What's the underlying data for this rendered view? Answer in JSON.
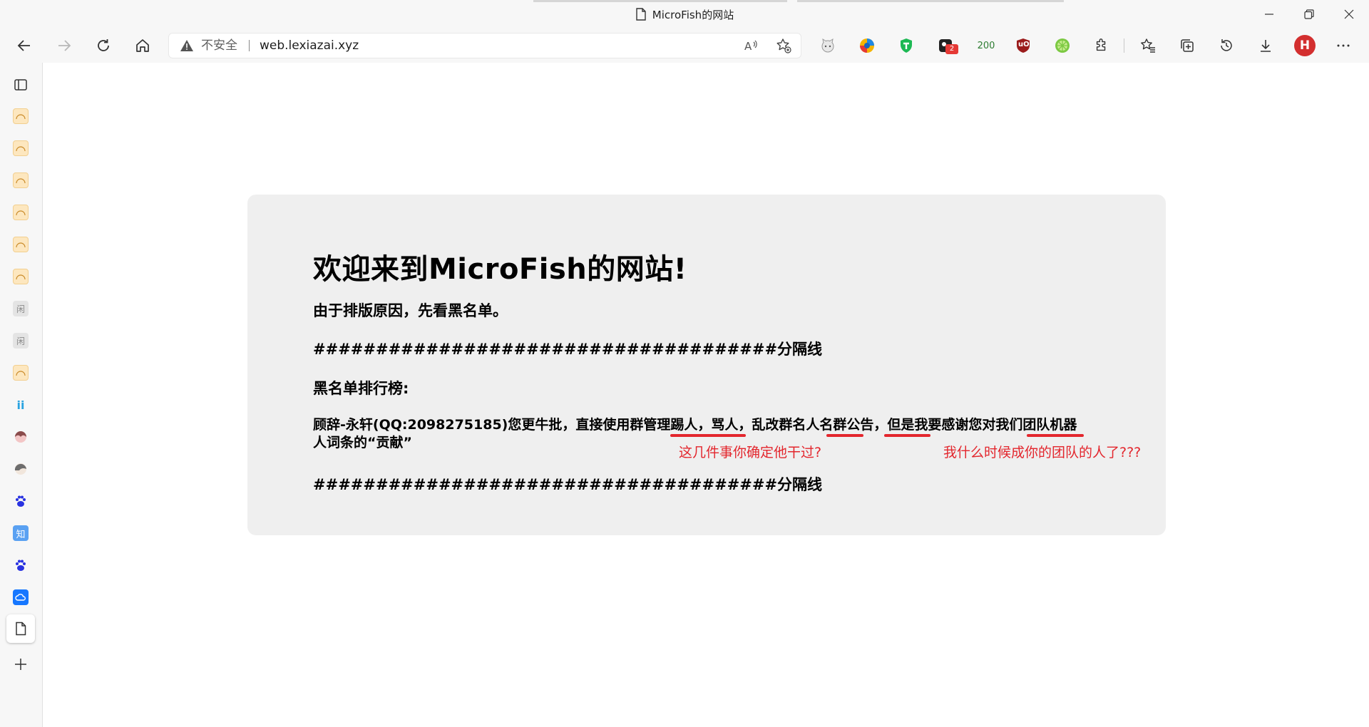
{
  "window": {
    "title": "MicroFish的网站",
    "page_icon": "document-icon",
    "controls": [
      "minimize-icon",
      "restore-icon",
      "close-icon"
    ]
  },
  "toolbar": {
    "nav": [
      "back-icon",
      "forward-icon",
      "refresh-icon",
      "home-icon"
    ],
    "address": {
      "security_label": "不安全",
      "url": "web.lexiazai.xyz",
      "icons": [
        "read-aloud-icon",
        "add-favorite-icon"
      ]
    },
    "extensions": [
      {
        "name": "cat-extension-icon"
      },
      {
        "name": "colorful-extension-icon"
      },
      {
        "name": "green-shield-extension-icon"
      },
      {
        "name": "dark-extension-icon",
        "badge": "2"
      },
      {
        "name": "counter-extension",
        "text": "200"
      },
      {
        "name": "ublock-origin-icon",
        "text": "uO"
      },
      {
        "name": "lime-extension-icon"
      },
      {
        "name": "extensions-puzzle-icon"
      }
    ],
    "actions": [
      "favorites-icon",
      "collections-icon",
      "history-icon",
      "downloads-icon"
    ],
    "profile_initial": "H",
    "menu_icon": "more-icon",
    "colors": {
      "accent_red": "#e3262d",
      "avatar_red": "#d32f2f",
      "ublock_red": "#9b1c1c"
    }
  },
  "sidebar": {
    "top_icon": "tab-actions-icon",
    "items": [
      {
        "name": "favicon-fish",
        "glyph": ""
      },
      {
        "name": "favicon-fish",
        "glyph": ""
      },
      {
        "name": "favicon-fish",
        "glyph": ""
      },
      {
        "name": "favicon-fish",
        "glyph": ""
      },
      {
        "name": "favicon-fish",
        "glyph": ""
      },
      {
        "name": "favicon-fish",
        "glyph": ""
      },
      {
        "name": "favicon-xian",
        "glyph": "闲"
      },
      {
        "name": "favicon-xian",
        "glyph": "闲"
      },
      {
        "name": "favicon-fish",
        "glyph": ""
      },
      {
        "name": "favicon-ii",
        "glyph": "ii"
      },
      {
        "name": "favicon-anime-girl",
        "glyph": ""
      },
      {
        "name": "favicon-anime-girl-2",
        "glyph": ""
      },
      {
        "name": "baidu-paw-icon",
        "glyph": ""
      },
      {
        "name": "zhihu-icon",
        "glyph": "知"
      },
      {
        "name": "baidu-paw-icon",
        "glyph": ""
      },
      {
        "name": "cloud-icon",
        "glyph": ""
      }
    ],
    "active_item": "document-icon",
    "add_icon": "plus-icon"
  },
  "page": {
    "heading": "欢迎来到MicroFish的网站!",
    "line1": "由于排版原因，先看黑名单。",
    "divider1": "#####################################分隔线",
    "blacklist_title": "黑名单排行榜:",
    "entry": "顾辞-永轩(QQ:2098275185)您更牛批，直接使用群管理踢人，骂人，乱改群名人名群公告，但是我要感谢您对我们团队机器人词条的“贡献”",
    "divider2": "#####################################分隔线"
  },
  "annotations": {
    "note1": "这几件事你确定他干过?",
    "note2": "我什么时候成你的团队的人了???"
  }
}
